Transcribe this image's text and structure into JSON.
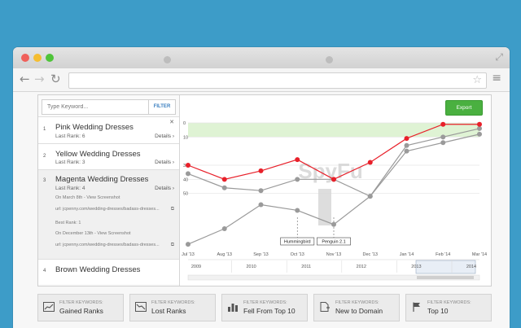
{
  "search": {
    "placeholder": "Type Keyword...",
    "filter_label": "FILTER"
  },
  "export_label": "Export",
  "keywords": [
    {
      "num": "1",
      "name": "Pink Wedding Dresses",
      "rank": "Last Rank: 6",
      "details": "Details"
    },
    {
      "num": "2",
      "name": "Yellow Wedding Dresses",
      "rank": "Last Rank: 3",
      "details": "Details"
    },
    {
      "num": "3",
      "name": "Magenta Wedding Dresses",
      "rank": "Last Rank: 4",
      "details": "Details",
      "lines": [
        "On March 8th - View Screenshot",
        "url: jcpenny.com/wedding-dresses/badass-dresses...",
        "Best Rank: 1",
        "On December 13th - View Screenshot",
        "url: jcpenny.com/wedding-dresses/badass-dresses..."
      ]
    },
    {
      "num": "4",
      "name": "Brown Wedding Dresses"
    }
  ],
  "chart_data": {
    "type": "line",
    "x": [
      "Jul '13",
      "Aug '13",
      "Sep '13",
      "Oct '13",
      "Nov '13",
      "Dec '13",
      "Jan '14",
      "Feb '14",
      "Mar '14"
    ],
    "yticks": [
      0,
      10,
      30,
      40,
      50
    ],
    "ylim": [
      0,
      90
    ],
    "series": [
      {
        "color": "#e8202a",
        "values": [
          30,
          40,
          34,
          26,
          40,
          28,
          11,
          1,
          1
        ]
      },
      {
        "color": "#9a9a9a",
        "values": [
          36,
          46,
          48,
          40,
          40,
          52,
          16,
          10,
          4
        ]
      },
      {
        "color": "#9a9a9a",
        "values": [
          86,
          75,
          58,
          62,
          72,
          52,
          20,
          14,
          8
        ]
      }
    ],
    "annotations": [
      {
        "label": "Hummingbird",
        "x": "Oct '13"
      },
      {
        "label": "Penguin 2.1",
        "x": "Nov '13"
      }
    ],
    "navigator_years": [
      "2009",
      "2010",
      "2011",
      "2012",
      "2013",
      "2014"
    ],
    "watermark": "SpyFu",
    "highlight_band": [
      0,
      10
    ]
  },
  "filter_buttons": [
    {
      "small": "FILTER KEYWORDS:",
      "big": "Gained Ranks",
      "icon": "chart-up-icon"
    },
    {
      "small": "FILTER KEYWORDS:",
      "big": "Lost Ranks",
      "icon": "chart-down-icon"
    },
    {
      "small": "FILTER KEYWORDS:",
      "big": "Fell From Top 10",
      "icon": "bar-chart-icon"
    },
    {
      "small": "FILTER KEYWORDS:",
      "big": "New to Domain",
      "icon": "new-doc-icon"
    },
    {
      "small": "FILTER KEYWORDS:",
      "big": "Top 10",
      "icon": "flag-icon"
    }
  ]
}
